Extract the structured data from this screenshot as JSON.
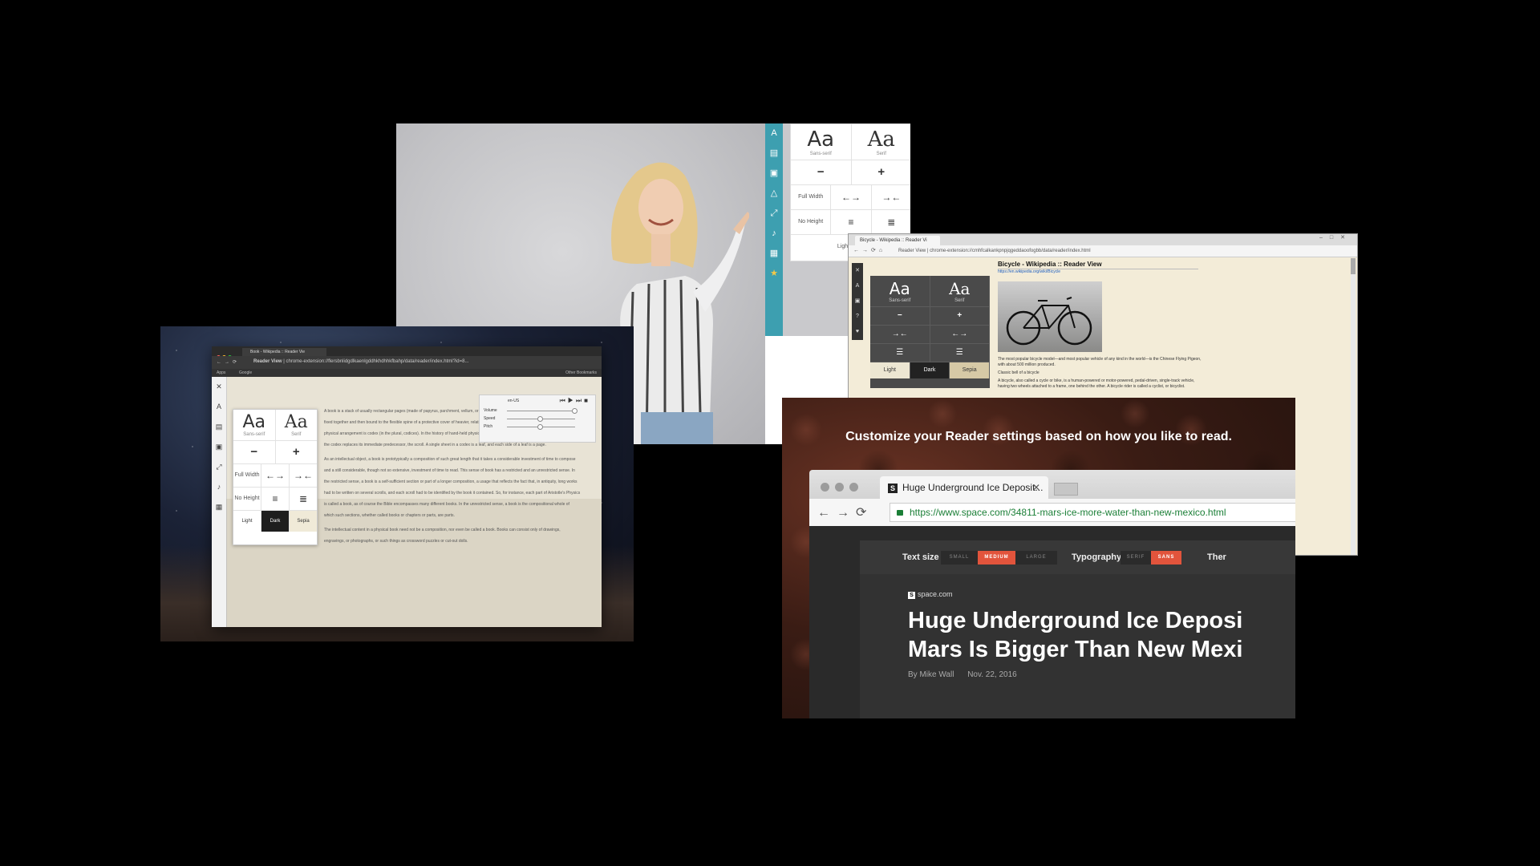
{
  "panel_a": {
    "toolbar_icons": [
      "font-icon",
      "print-icon",
      "save-icon",
      "drive-icon",
      "fullscreen-icon",
      "speaker-icon",
      "image-icon",
      "star-icon"
    ],
    "settings": {
      "sans_label": "Aa",
      "sans_sub": "Sans-serif",
      "serif_label": "Aa",
      "serif_sub": "Serif",
      "minus": "−",
      "plus": "+",
      "full_width": "Full Width",
      "no_height": "No Height",
      "light": "Light"
    }
  },
  "panel_b": {
    "tab_title": "Bicycle - Wikipedia :: Reader Vi",
    "url": "chrome-extension://cmhfcalkankpnpjqgeddaoofogbb/data/reader/index.html",
    "url_prefix": "Reader View",
    "settings": {
      "sans_label": "Aa",
      "sans_sub": "Sans-serif",
      "serif_label": "Aa",
      "serif_sub": "Serif",
      "minus": "−",
      "plus": "+",
      "theme_light": "Light",
      "theme_dark": "Dark",
      "theme_sepia": "Sepia"
    },
    "content": {
      "title": "Bicycle - Wikipedia :: Reader View",
      "source_link": "https://en.wikipedia.org/wiki/Bicycle",
      "para1": "The most popular bicycle model—and most popular vehicle of any kind in the world—is the Chinese Flying Pigeon, with about 500 million produced.",
      "caption": "Classic bell of a bicycle",
      "para2": "A bicycle, also called a cycle or bike, is a human-powered or motor-powered, pedal-driven, single-track vehicle, having two wheels attached to a frame, one behind the other. A bicycle rider is called a cyclist, or bicyclist."
    }
  },
  "panel_c": {
    "tab_title": "Book - Wikipedia :: Reader Vie",
    "url_prefix": "Reader View",
    "url": "chrome-extension://flersbnlidgdlkaenlgddhkhdhhkfbahp/data/reader/index.html?id=8...",
    "bookmarks_apps": "Apps",
    "bookmarks_google": "Google",
    "bookmarks_other": "Other Bookmarks",
    "settings": {
      "sans_label": "Aa",
      "sans_sub": "Sans-serif",
      "serif_label": "Aa",
      "serif_sub": "Serif",
      "minus": "−",
      "plus": "+",
      "full_width": "Full Width",
      "no_height": "No Height",
      "theme_light": "Light",
      "theme_dark": "Dark",
      "theme_sepia": "Sepia"
    },
    "tts": {
      "voice": "en-US",
      "volume": "Volume",
      "speed": "Speed",
      "pitch": "Pitch"
    },
    "paragraphs": [
      "A book is a stack of usually rectangular pages (made of papyrus, parchment, vellum, or paper) oriented with one edge tied, sewn, or otherwise fixed together and then bound to the flexible spine of a protective cover of heavier, relatively inflexible material. The technical term for this physical arrangement is codex (in the plural, codices). In the history of hand-held physical supports for extended written compositions or records, the codex replaces its immediate predecessor, the scroll. A single sheet in a codex is a leaf, and each side of a leaf is a page.",
      "As an intellectual object, a book is prototypically a composition of such great length that it takes a considerable investment of time to compose and a still considerable, though not so extensive, investment of time to read. This sense of book has a restricted and an unrestricted sense. In the restricted sense, a book is a self-sufficient section or part of a longer composition, a usage that reflects the fact that, in antiquity, long works had to be written on several scrolls, and each scroll had to be identified by the book it contained. So, for instance, each part of Aristotle's Physics is called a book, as of course the Bible encompasses many different books. In the unrestricted sense, a book is the compositional whole of which such sections, whether called books or chapters or parts, are parts.",
      "The intellectual content in a physical book need not be a composition, nor even be called a book. Books can consist only of drawings, engravings, or photographs, or such things as crossword puzzles or cut-out dolls."
    ]
  },
  "panel_d": {
    "headline": "Customize your Reader settings based on how you like to read.",
    "tab_title": "Huge Underground Ice Deposit...",
    "url": "https://www.space.com/34811-mars-ice-more-water-than-new-mexico.html",
    "text_size_label": "Text size",
    "size_small": "SMALL",
    "size_medium": "MEDIUM",
    "size_large": "LARGE",
    "typography_label": "Typography",
    "type_serif": "SERIF",
    "type_sans": "SANS",
    "theme_label": "Ther",
    "source": "space.com",
    "article_title_1": "Huge Underground Ice Deposi",
    "article_title_2": "Mars Is Bigger Than New Mexi",
    "author": "By Mike Wall",
    "date": "Nov. 22, 2016"
  },
  "colors": {
    "teal_toolbar": "#3d9fb0",
    "accent_orange": "#e2543c",
    "sepia_bg": "#f3ecd8"
  }
}
